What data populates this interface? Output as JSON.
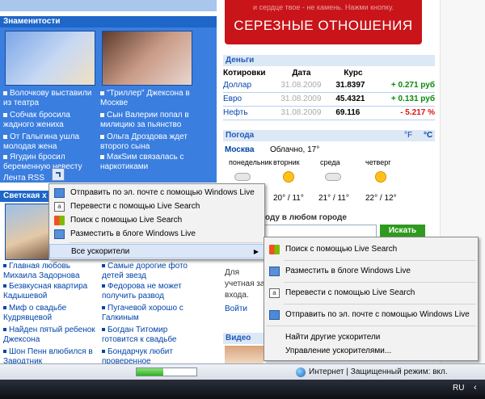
{
  "celebs": {
    "title": "Знаменитости",
    "left_stories": [
      "Волочкову выставили из театра",
      "Собчак бросила жадного жениха",
      "От Галыгина ушла молодая жена",
      "Ягудин бросил беременную невесту"
    ],
    "right_stories": [
      "\"Триллер\" Джексона в Москве",
      "Сын Валерии попал в милицию за пьянство",
      "Ольга Дроздова ждет второго сына",
      "МакSим связалась с наркотиками"
    ],
    "rss": "Лента RSS"
  },
  "social": {
    "title": "Светская х",
    "left_news": [
      "Главная любовь Михаила Задорнова",
      "Безвкусная квартира Кадышевой",
      "Миф о свадьбе Кудрявцевой",
      "Найден пятый ребенок Джексона",
      "Шон Пенн влюбился в Заводтник"
    ],
    "right_news": [
      "Самые дорогие фото детей звезд",
      "Федорова не может получить развод",
      "Пугачевой хорошо с Галкиным",
      "Богдан Титомир готовится к свадьбе",
      "Бондарчук любит проверенное"
    ]
  },
  "promo": {
    "faint": "и сердце твое - не камень. Нажми кнопку.",
    "headline": "СЕРЕЗНЫЕ ОТНОШЕНИЯ"
  },
  "money": {
    "title": "Деньги",
    "headers": [
      "Котировки",
      "Дата",
      "Курс"
    ],
    "rows": [
      {
        "name": "Доллар",
        "date": "31.08.2009",
        "rate": "31.8397",
        "change": "+ 0.271 руб",
        "dir": "up"
      },
      {
        "name": "Евро",
        "date": "31.08.2009",
        "rate": "45.4321",
        "change": "+ 0.131 руб",
        "dir": "up"
      },
      {
        "name": "Нефть",
        "date": "31.08.2009",
        "rate": "69.116",
        "change": "- 5.217 %",
        "dir": "down"
      }
    ]
  },
  "weather": {
    "title": "Погода",
    "units_f": "°F",
    "units_c": "°C",
    "city": "Москва",
    "now": "Облачно, 17°",
    "days": [
      {
        "label": "понедельник",
        "temp": "",
        "kind": "cloud"
      },
      {
        "label": "вторник",
        "temp": "20° / 11°",
        "kind": "sun"
      },
      {
        "label": "среда",
        "temp": "21° / 11°",
        "kind": "cloud"
      },
      {
        "label": "четверг",
        "temp": "22° / 12°",
        "kind": "sun"
      }
    ],
    "search_label": "оду в любом городе",
    "search_button": "Искать"
  },
  "side_text": {
    "line1": "Для",
    "line2": "учетная за",
    "line3": "входа.",
    "login": "Войти"
  },
  "video_title": "Видео",
  "context_menu": {
    "items": [
      "Отправить по эл. почте с помощью Windows Live",
      "Перевести с помощью Live Search",
      "Поиск с помощью Live Search",
      "Разместить в блоге Windows Live",
      "Все ускорители"
    ],
    "highlighted_index": 4
  },
  "submenu": {
    "items": [
      "Поиск с помощью Live Search",
      "Разместить в блоге Windows Live",
      "Перевести с помощью Live Search",
      "Отправить по эл. почте с помощью Windows Live"
    ],
    "extra": [
      "Найти другие ускорители",
      "Управление ускорителями..."
    ]
  },
  "status": {
    "zone": "Интернет | Защищенный режим: вкл.",
    "progress": 0.45
  },
  "taskbar": {
    "lang": "RU"
  }
}
